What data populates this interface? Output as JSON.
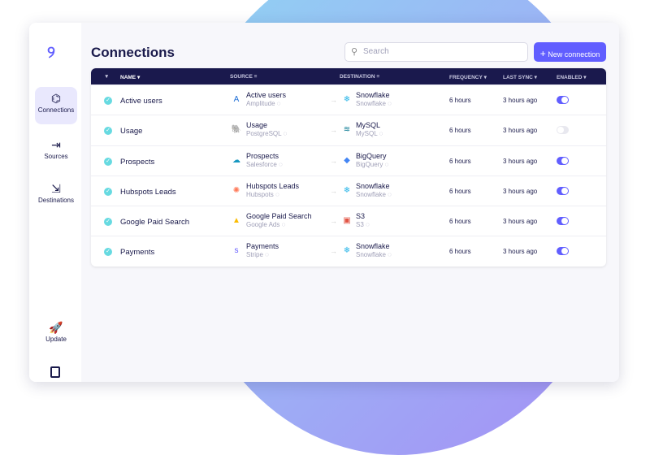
{
  "sidebar": {
    "items": [
      {
        "label": "Connections",
        "icon": "connections-icon"
      },
      {
        "label": "Sources",
        "icon": "sources-icon"
      },
      {
        "label": "Destinations",
        "icon": "destinations-icon"
      },
      {
        "label": "Update",
        "icon": "rocket-icon"
      }
    ]
  },
  "header": {
    "title": "Connections",
    "search_placeholder": "Search",
    "new_button": "New connection"
  },
  "table": {
    "columns": [
      "NAME",
      "SOURCE",
      "DESTINATION",
      "FREQUENCY",
      "LAST SYNC",
      "ENABLED"
    ],
    "rows": [
      {
        "name": "Active users",
        "source": "Active users",
        "source_type": "Amplitude",
        "dest": "Snowflake",
        "dest_type": "Snowflake",
        "frequency": "6 hours",
        "last_sync": "3 hours ago",
        "enabled": true
      },
      {
        "name": "Usage",
        "source": "Usage",
        "source_type": "PostgreSQL",
        "dest": "MySQL",
        "dest_type": "MySQL",
        "frequency": "6 hours",
        "last_sync": "3 hours ago",
        "enabled": false
      },
      {
        "name": "Prospects",
        "source": "Prospects",
        "source_type": "Salesforce",
        "dest": "BigQuery",
        "dest_type": "BigQuery",
        "frequency": "6 hours",
        "last_sync": "3 hours ago",
        "enabled": true
      },
      {
        "name": "Hubspots Leads",
        "source": "Hubspots Leads",
        "source_type": "Hubspots",
        "dest": "Snowflake",
        "dest_type": "Snowflake",
        "frequency": "6 hours",
        "last_sync": "3 hours ago",
        "enabled": true
      },
      {
        "name": "Google Paid Search",
        "source": "Google Paid Search",
        "source_type": "Google Ads",
        "dest": "S3",
        "dest_type": "S3",
        "frequency": "6 hours",
        "last_sync": "3 hours ago",
        "enabled": true
      },
      {
        "name": "Payments",
        "source": "Payments",
        "source_type": "Stripe",
        "dest": "Snowflake",
        "dest_type": "Snowflake",
        "frequency": "6 hours",
        "last_sync": "3 hours ago",
        "enabled": true
      }
    ]
  },
  "colors": {
    "accent": "#615eff",
    "header_bg": "#1a194d",
    "check": "#67dae1"
  }
}
